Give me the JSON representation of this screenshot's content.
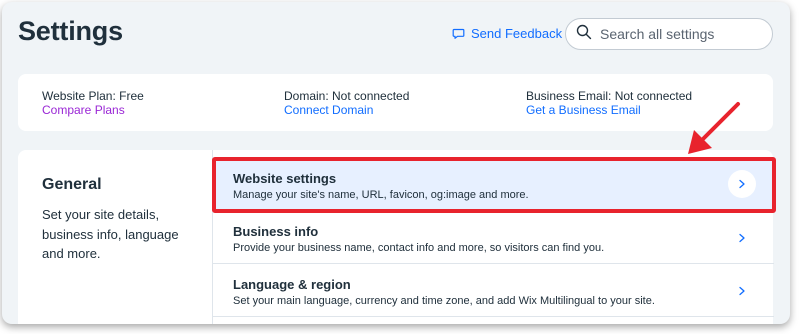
{
  "header": {
    "title": "Settings",
    "feedback_label": "Send Feedback",
    "search_placeholder": "Search all settings"
  },
  "plan_bar": {
    "plan": {
      "label": "Website Plan: Free",
      "link": "Compare Plans"
    },
    "domain": {
      "label": "Domain: Not connected",
      "link": "Connect Domain"
    },
    "email": {
      "label": "Business Email: Not connected",
      "link": "Get a Business Email"
    }
  },
  "general": {
    "title": "General",
    "description": "Set your site details, business info, language and more.",
    "items": [
      {
        "title": "Website settings",
        "subtitle": "Manage your site's name, URL, favicon, og:image and more."
      },
      {
        "title": "Business info",
        "subtitle": "Provide your business name, contact info and more, so visitors can find you."
      },
      {
        "title": "Language & region",
        "subtitle": "Set your main language, currency and time zone, and add Wix Multilingual to your site."
      }
    ]
  },
  "colors": {
    "accent": "#116dff",
    "link_purple": "#9a27d5",
    "annotation_red": "#e8232d",
    "background": "#f0f4f7",
    "selected_row": "#e7f0ff"
  },
  "icons": {
    "feedback": "chat-bubble-icon",
    "search": "search-icon",
    "chevron": "chevron-right-icon"
  }
}
